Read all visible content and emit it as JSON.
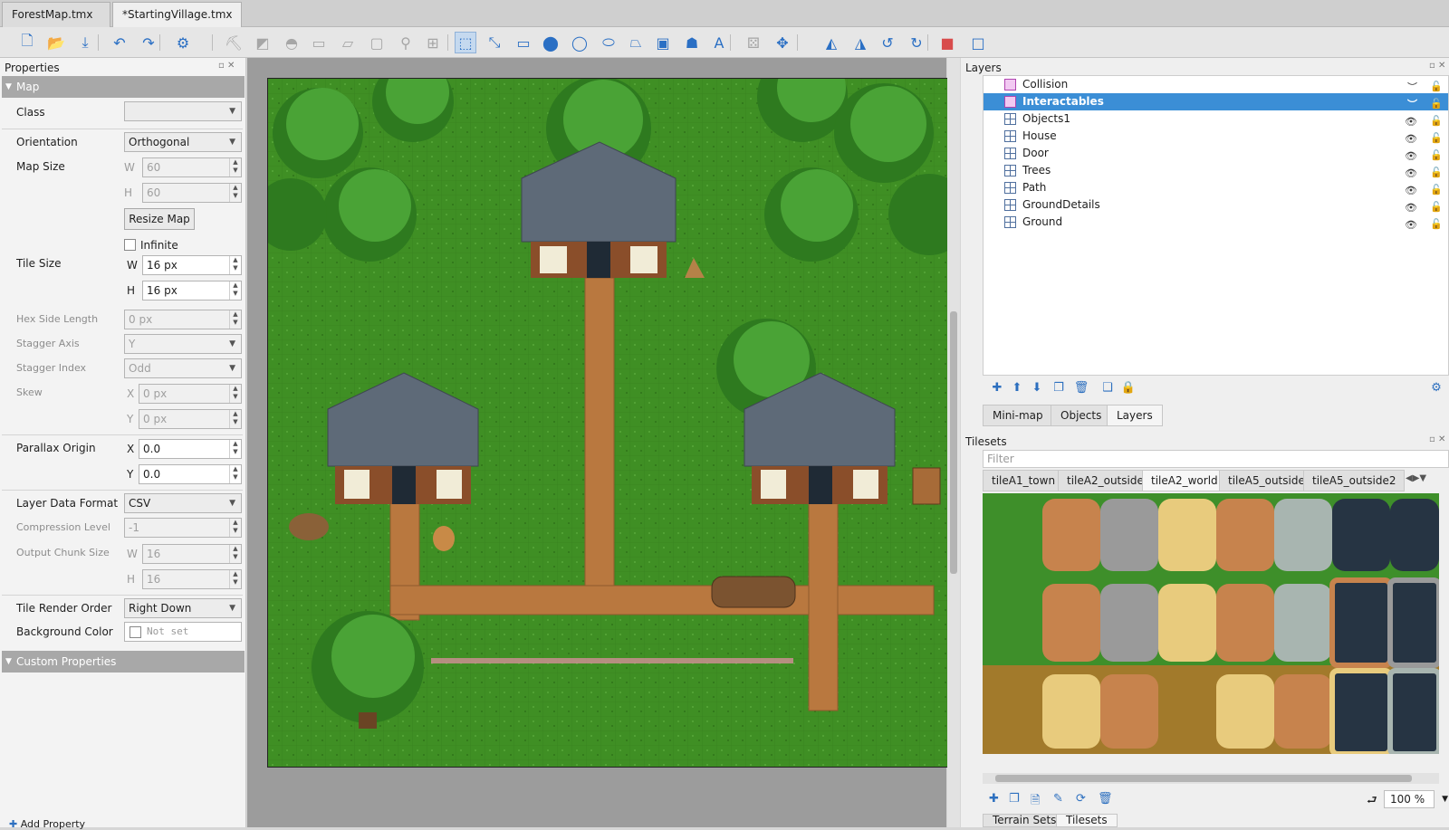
{
  "tabs": [
    {
      "label": "ForestMap.tmx",
      "active": false
    },
    {
      "label": "*StartingVillage.tmx",
      "active": true
    }
  ],
  "toolbar": {
    "icons": [
      "new-map-icon",
      "open-icon",
      "save-icon",
      "undo-icon",
      "redo-icon",
      "commands-icon",
      "stamp-brush-icon",
      "terrain-brush-icon",
      "bucket-fill-icon",
      "shape-fill-icon",
      "eraser-icon",
      "rect-select-icon",
      "magic-wand-icon",
      "select-same-tile-icon",
      "select-objects-icon",
      "edit-polygons-icon",
      "insert-rectangle-icon",
      "insert-point-icon",
      "insert-ellipse-icon",
      "insert-polygon-icon",
      "insert-polyline-icon",
      "insert-tile-icon",
      "insert-template-icon",
      "insert-text-icon",
      "random-mode-icon",
      "wang-fill-icon",
      "flip-horizontal-icon",
      "flip-vertical-icon",
      "rotate-left-icon",
      "rotate-right-icon",
      "highlight-layer-icon",
      "show-world-icon"
    ]
  },
  "properties": {
    "title": "Properties",
    "section_map": "Map",
    "class_label": "Class",
    "class_value": "",
    "orientation_label": "Orientation",
    "orientation_value": "Orthogonal",
    "map_size_label": "Map Size",
    "w": "W",
    "h": "H",
    "map_width": "60",
    "map_height": "60",
    "resize_button": "Resize Map",
    "infinite_label": "Infinite",
    "tile_size_label": "Tile Size",
    "tile_width": "16 px",
    "tile_height": "16 px",
    "hex_side_label": "Hex Side Length",
    "hex_side_value": "0 px",
    "stagger_axis_label": "Stagger Axis",
    "stagger_axis_value": "Y",
    "stagger_index_label": "Stagger Index",
    "stagger_index_value": "Odd",
    "skew_label": "Skew",
    "x": "X",
    "y": "Y",
    "skew_x": "0 px",
    "skew_y": "0 px",
    "parallax_label": "Parallax Origin",
    "parallax_x": "0.0",
    "parallax_y": "0.0",
    "layer_format_label": "Layer Data Format",
    "layer_format_value": "CSV",
    "compression_label": "Compression Level",
    "compression_value": "-1",
    "chunk_label": "Output Chunk Size",
    "chunk_w": "16",
    "chunk_h": "16",
    "render_order_label": "Tile Render Order",
    "render_order_value": "Right Down",
    "bg_color_label": "Background Color",
    "bg_color_value": "Not set",
    "section_custom": "Custom Properties",
    "add_property": "Add Property"
  },
  "layers": {
    "title": "Layers",
    "items": [
      {
        "name": "Collision",
        "kind": "object-layer-icon",
        "selected": false,
        "visible": false
      },
      {
        "name": "Interactables",
        "kind": "object-layer-icon",
        "selected": true,
        "visible": false
      },
      {
        "name": "Objects1",
        "kind": "tile-layer-icon",
        "selected": false,
        "visible": true
      },
      {
        "name": "House",
        "kind": "tile-layer-icon",
        "selected": false,
        "visible": true
      },
      {
        "name": "Door",
        "kind": "tile-layer-icon",
        "selected": false,
        "visible": true
      },
      {
        "name": "Trees",
        "kind": "tile-layer-icon",
        "selected": false,
        "visible": true
      },
      {
        "name": "Path",
        "kind": "tile-layer-icon",
        "selected": false,
        "visible": true
      },
      {
        "name": "GroundDetails",
        "kind": "tile-layer-icon",
        "selected": false,
        "visible": true
      },
      {
        "name": "Ground",
        "kind": "tile-layer-icon",
        "selected": false,
        "visible": true
      }
    ],
    "bottom_tabs": [
      "Mini-map",
      "Objects",
      "Layers"
    ]
  },
  "tilesets": {
    "title": "Tilesets",
    "filter_placeholder": "Filter",
    "tabs": [
      "tileA1_town",
      "tileA2_outside",
      "tileA2_world",
      "tileA5_outside",
      "tileA5_outside2"
    ],
    "zoom": "100 %",
    "bottom_tabs": [
      "Terrain Sets",
      "Tilesets"
    ]
  },
  "colors": {
    "grass": "#3e8e22",
    "path": "#b8783f",
    "roof": "#5e6a78",
    "tree": "#2f7a22",
    "selection": "#3b8ed6"
  }
}
